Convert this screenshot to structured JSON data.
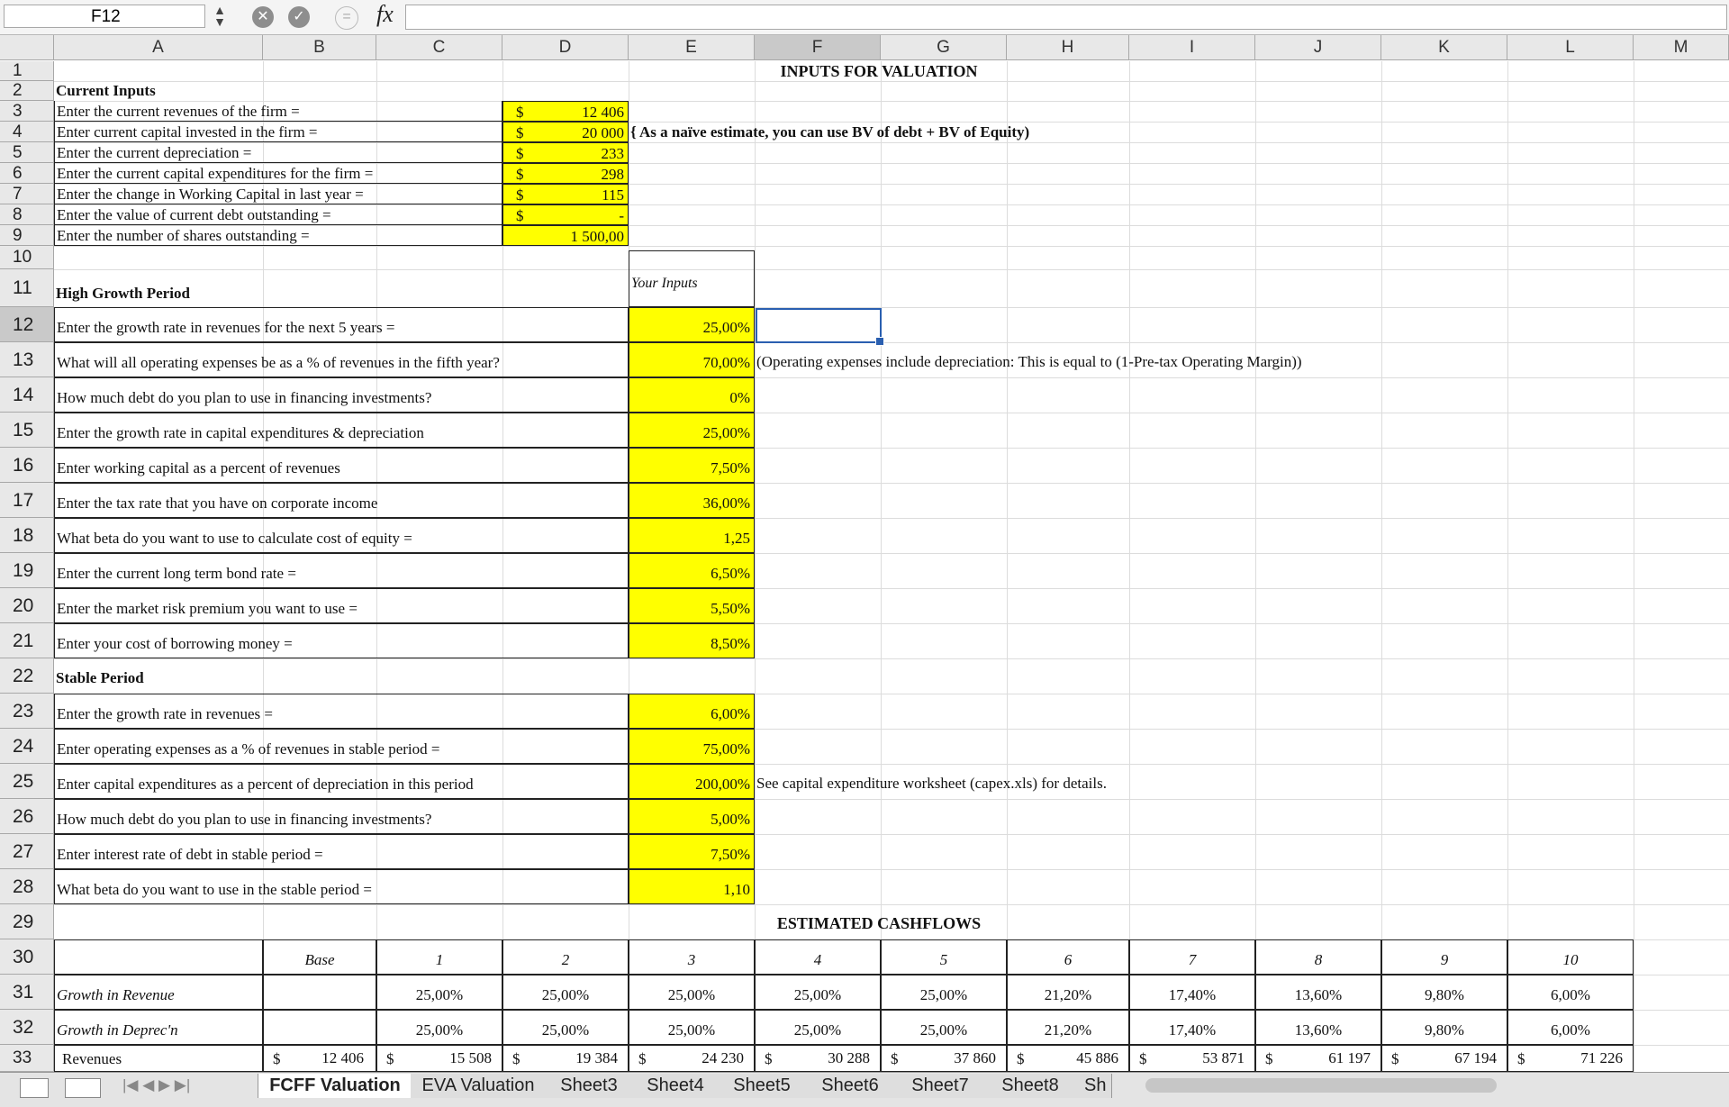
{
  "formula_bar": {
    "name_box": "F12",
    "fx": "fx",
    "formula": ""
  },
  "columns": [
    "A",
    "B",
    "C",
    "D",
    "E",
    "F",
    "G",
    "H",
    "I",
    "J",
    "K",
    "L",
    "M"
  ],
  "rows": [
    "1",
    "2",
    "3",
    "4",
    "5",
    "6",
    "7",
    "8",
    "9",
    "10",
    "11",
    "12",
    "13",
    "14",
    "15",
    "16",
    "17",
    "18",
    "19",
    "20",
    "21",
    "22",
    "23",
    "24",
    "25",
    "26",
    "27",
    "28",
    "29",
    "30",
    "31",
    "32",
    "33"
  ],
  "titles": {
    "inputs": "INPUTS FOR VALUATION",
    "cashflows": "ESTIMATED CASHFLOWS"
  },
  "current_inputs": {
    "header": "Current Inputs",
    "currency": "$",
    "items": [
      {
        "label": "Enter the current revenues of the firm =",
        "value": "12 406"
      },
      {
        "label": "Enter current capital invested in the firm =",
        "value": "20 000"
      },
      {
        "label": "Enter the current depreciation =",
        "value": "233"
      },
      {
        "label": "Enter the current capital expenditures for the firm =",
        "value": "298"
      },
      {
        "label": "Enter the change in Working Capital in last year =",
        "value": "115"
      },
      {
        "label": "Enter the value of current debt outstanding =",
        "value": "-"
      },
      {
        "label": "Enter the number of shares outstanding =",
        "value": "1 500,00"
      }
    ],
    "note": "{ As a naïve estimate, you can use BV of debt + BV of Equity)"
  },
  "high_growth": {
    "header": "High Growth Period",
    "inputs_label": "Your Inputs",
    "items": [
      {
        "label": "Enter the growth rate in revenues for the next 5 years =",
        "value": "25,00%"
      },
      {
        "label": "What will all operating expenses be as a % of revenues in the fifth year?",
        "value": "70,00%"
      },
      {
        "label": "How much debt do you plan to use in financing investments?",
        "value": "0%"
      },
      {
        "label": "Enter the growth rate in capital expenditures & depreciation",
        "value": "25,00%"
      },
      {
        "label": "Enter working capital as a percent of revenues",
        "value": "7,50%"
      },
      {
        "label": "Enter the tax rate that you have on corporate income",
        "value": "36,00%"
      },
      {
        "label": "What beta do you want to use to calculate cost of equity =",
        "value": "1,25"
      },
      {
        "label": "Enter the current long term bond rate =",
        "value": "6,50%"
      },
      {
        "label": "Enter the market risk premium you want to use =",
        "value": "5,50%"
      },
      {
        "label": "Enter your cost of borrowing money =",
        "value": "8,50%"
      }
    ],
    "opex_note": "(Operating expenses include depreciation: This is equal to (1-Pre-tax Operating Margin))"
  },
  "stable": {
    "header": "Stable Period",
    "items": [
      {
        "label": "Enter the growth rate in revenues =",
        "value": "6,00%"
      },
      {
        "label": "Enter operating expenses as a % of revenues in stable period =",
        "value": "75,00%"
      },
      {
        "label": "Enter capital expenditures as a percent of depreciation in this period",
        "value": "200,00%"
      },
      {
        "label": "How much debt do you plan to use in financing investments?",
        "value": "5,00%"
      },
      {
        "label": "Enter interest rate of debt in stable period =",
        "value": "7,50%"
      },
      {
        "label": "What beta do you want to use in the stable period =",
        "value": "1,10"
      }
    ],
    "capex_note": "See capital expenditure worksheet (capex.xls) for details."
  },
  "cashflows": {
    "base_label": "Base",
    "years": [
      "1",
      "2",
      "3",
      "4",
      "5",
      "6",
      "7",
      "8",
      "9",
      "10"
    ],
    "growth_revenue": {
      "label": "Growth in Revenue",
      "values": [
        "25,00%",
        "25,00%",
        "25,00%",
        "25,00%",
        "25,00%",
        "21,20%",
        "17,40%",
        "13,60%",
        "9,80%",
        "6,00%"
      ]
    },
    "growth_deprec": {
      "label": "Growth in Deprec'n",
      "values": [
        "25,00%",
        "25,00%",
        "25,00%",
        "25,00%",
        "25,00%",
        "21,20%",
        "17,40%",
        "13,60%",
        "9,80%",
        "6,00%"
      ]
    },
    "revenues": {
      "label": "Revenues",
      "currency": "$",
      "base": "12 406",
      "values": [
        "15 508",
        "19 384",
        "24 230",
        "30 288",
        "37 860",
        "45 886",
        "53 871",
        "61 197",
        "67 194",
        "71 226"
      ]
    }
  },
  "sheet_tabs": [
    "FCFF Valuation",
    "EVA Valuation",
    "Sheet3",
    "Sheet4",
    "Sheet5",
    "Sheet6",
    "Sheet7",
    "Sheet8",
    "Sh"
  ]
}
